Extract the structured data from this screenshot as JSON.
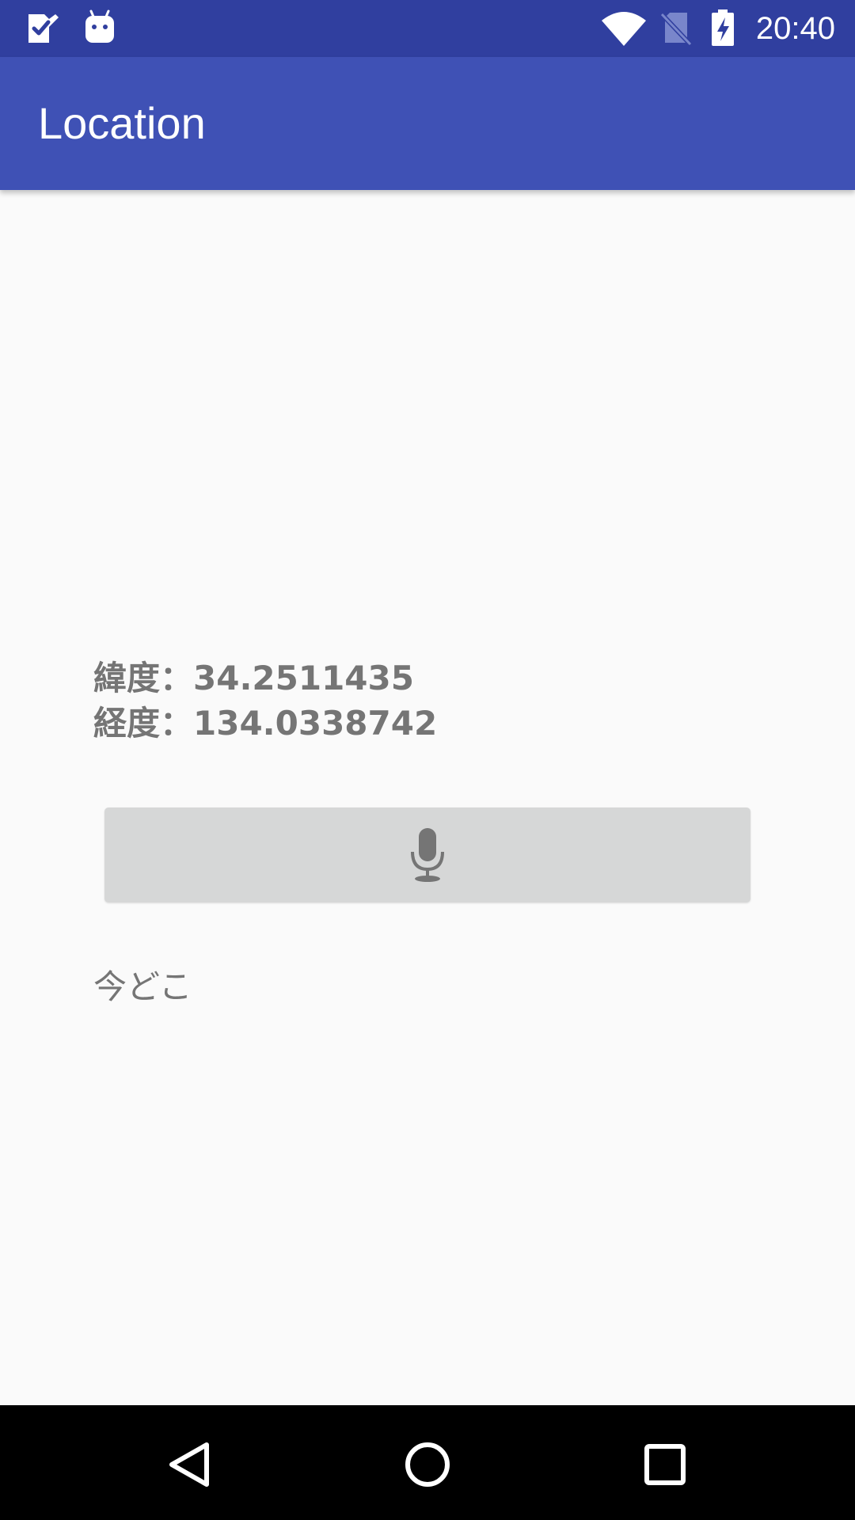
{
  "status_bar": {
    "time": "20:40",
    "icons": [
      "task-check-icon",
      "android-debug-icon",
      "wifi-icon",
      "no-sim-icon",
      "battery-charging-icon"
    ]
  },
  "app_bar": {
    "title": "Location"
  },
  "location": {
    "latitude_text": "緯度：34.2511435",
    "longitude_text": "経度：134.0338742"
  },
  "voice_button": {
    "icon": "microphone-icon"
  },
  "speech_result": "今どこ",
  "nav_bar": {
    "icons": [
      "back-icon",
      "home-icon",
      "recents-icon"
    ]
  },
  "colors": {
    "status_bar": "#303F9F",
    "app_bar": "#3F51B5",
    "background": "#FAFAFA",
    "text_gray": "#757575",
    "button_gray": "#D6D7D7",
    "nav_bar": "#000000"
  }
}
